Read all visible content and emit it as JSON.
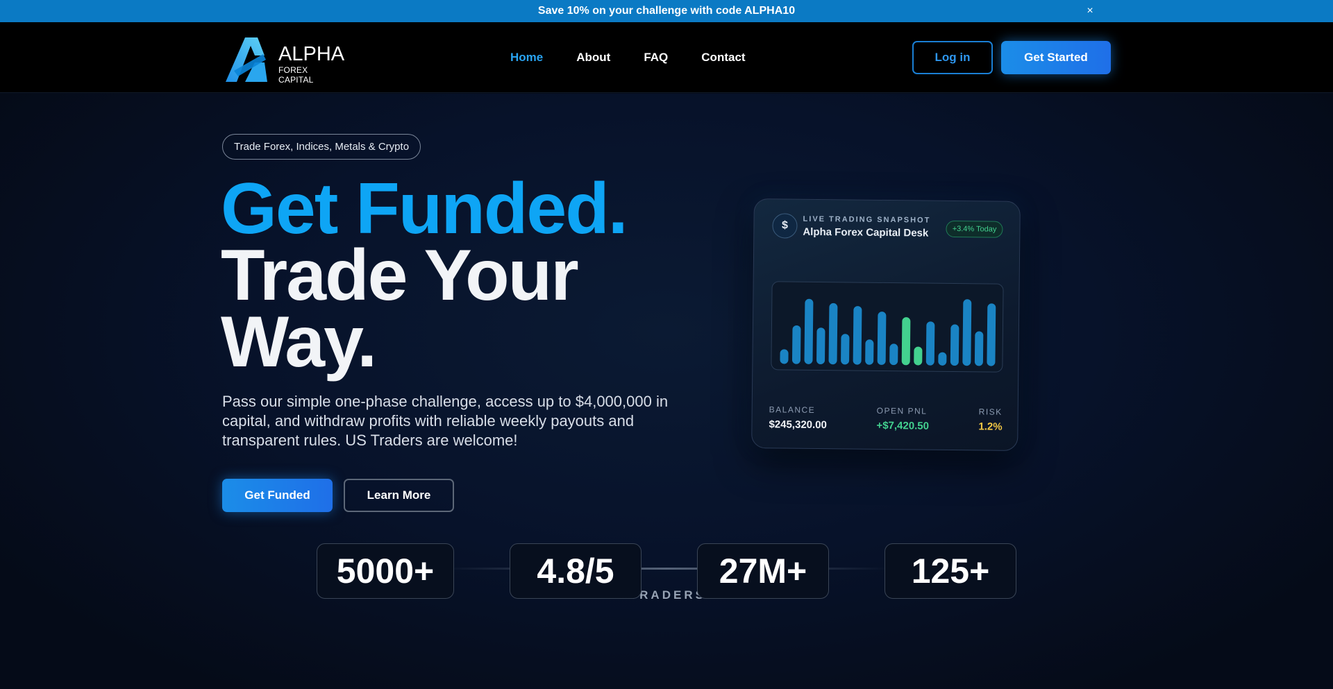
{
  "promo": {
    "text": "Save 10% on your challenge with code ALPHA10",
    "close_label": "×"
  },
  "header": {
    "logo": {
      "word": "ALPHA",
      "sub": "FOREX CAPITAL"
    },
    "nav": [
      {
        "label": "Home",
        "active": true
      },
      {
        "label": "About",
        "active": false
      },
      {
        "label": "FAQ",
        "active": false
      },
      {
        "label": "Contact",
        "active": false
      }
    ],
    "login_label": "Log in",
    "get_started_label": "Get Started"
  },
  "hero": {
    "tagline": "Trade Forex, Indices, Metals & Crypto",
    "headline_line1": "Get Funded.",
    "headline_line2": "Trade Your",
    "headline_line3": "Way.",
    "subtext": "Pass our simple one-phase challenge, access up to $4,000,000 in capital, and withdraw profits with reliable weekly payouts and transparent rules. US Traders are welcome!",
    "primary_cta": "Get Funded",
    "secondary_cta": "Learn More"
  },
  "snapshot_card": {
    "icon_glyph": "$",
    "kicker": "LIVE TRADING SNAPSHOT",
    "title": "Alpha Forex Capital Desk",
    "badge": "+3.4% Today",
    "bars": [
      {
        "value": 0.22,
        "highlight": false
      },
      {
        "value": 0.58,
        "highlight": false
      },
      {
        "value": 0.98,
        "highlight": false
      },
      {
        "value": 0.55,
        "highlight": false
      },
      {
        "value": 0.92,
        "highlight": false
      },
      {
        "value": 0.46,
        "highlight": false
      },
      {
        "value": 0.88,
        "highlight": false
      },
      {
        "value": 0.38,
        "highlight": false
      },
      {
        "value": 0.8,
        "highlight": false
      },
      {
        "value": 0.32,
        "highlight": false
      },
      {
        "value": 0.72,
        "highlight": true
      },
      {
        "value": 0.28,
        "highlight": true
      },
      {
        "value": 0.66,
        "highlight": false
      },
      {
        "value": 0.2,
        "highlight": false
      },
      {
        "value": 0.62,
        "highlight": false
      },
      {
        "value": 1.0,
        "highlight": false
      },
      {
        "value": 0.52,
        "highlight": false
      },
      {
        "value": 0.94,
        "highlight": false
      }
    ],
    "stats": {
      "balance_label": "BALANCE",
      "balance_value": "$245,320.00",
      "pnl_label": "OPEN PNL",
      "pnl_value": "+$7,420.50",
      "risk_label": "RISK",
      "risk_value": "1.2%"
    }
  },
  "trusted": {
    "heading": "TRUSTED BY TRADERS WORLDWIDE",
    "stats": [
      "5000+",
      "4.8/5",
      "27M+",
      "125+"
    ]
  },
  "colors": {
    "promo_bg": "#0b7ac4",
    "accent_blue": "#0ea5f5",
    "green": "#43d18f",
    "yellow": "#f2c744",
    "background": "#050b18"
  }
}
